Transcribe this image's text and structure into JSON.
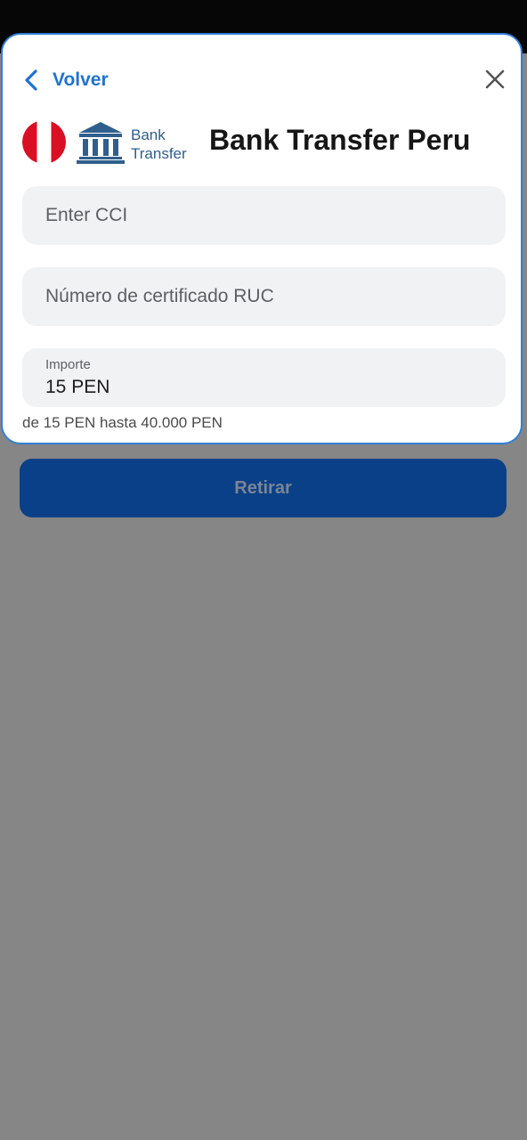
{
  "header": {
    "back_label": "Volver",
    "close_icon": "close-icon"
  },
  "provider": {
    "flag_icon": "peru-flag-icon",
    "logo_icon": "bank-building-icon",
    "logo_line1": "Bank",
    "logo_line2": "Transfer",
    "title": "Bank Transfer Peru"
  },
  "form": {
    "cci_placeholder": "Enter CCI",
    "ruc_placeholder": "Número de certificado RUC",
    "amount_label": "Importe",
    "amount_value": "15 PEN",
    "range_hint": "de 15 PEN hasta 40.000 PEN"
  },
  "actions": {
    "submit_label": "Retirar"
  },
  "colors": {
    "accent": "#1f73d4",
    "sheet_border": "#2f7fdb",
    "button_bg": "#0a4088",
    "button_text": "#7c8593",
    "overlay": "#868686",
    "flag_red": "#d91023"
  }
}
